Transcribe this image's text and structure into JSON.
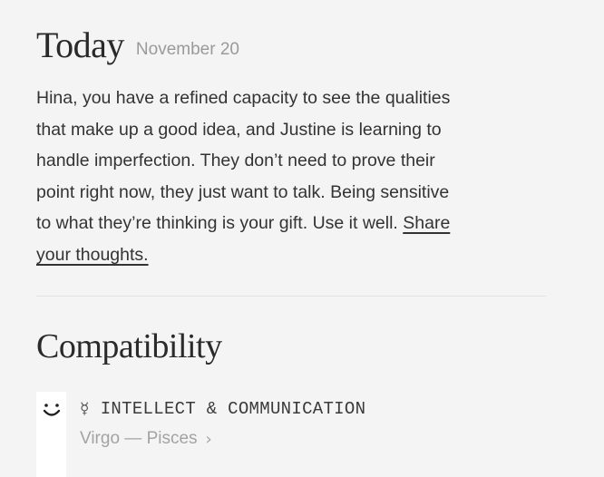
{
  "today": {
    "title": "Today",
    "date": "November 20",
    "lines": [
      "Hina, you have a refined capacity to see the qualities",
      "that make up a good idea, and Justine is learning to",
      "handle imperfection. They don’t need to prove their",
      "point right now, they just want to talk. Being sensitive"
    ],
    "line5_text": "to what they’re thinking is your gift. Use it well. ",
    "share_part1": "Share",
    "share_part2": "your thoughts."
  },
  "compatibility": {
    "title": "Compatibility",
    "items": [
      {
        "icon": "smile-icon",
        "symbol": "☿",
        "symbol_icon": "mercury-icon",
        "heading": "INTELLECT & COMMUNICATION",
        "signs": "Virgo — Pisces",
        "chevron": "›"
      }
    ]
  }
}
